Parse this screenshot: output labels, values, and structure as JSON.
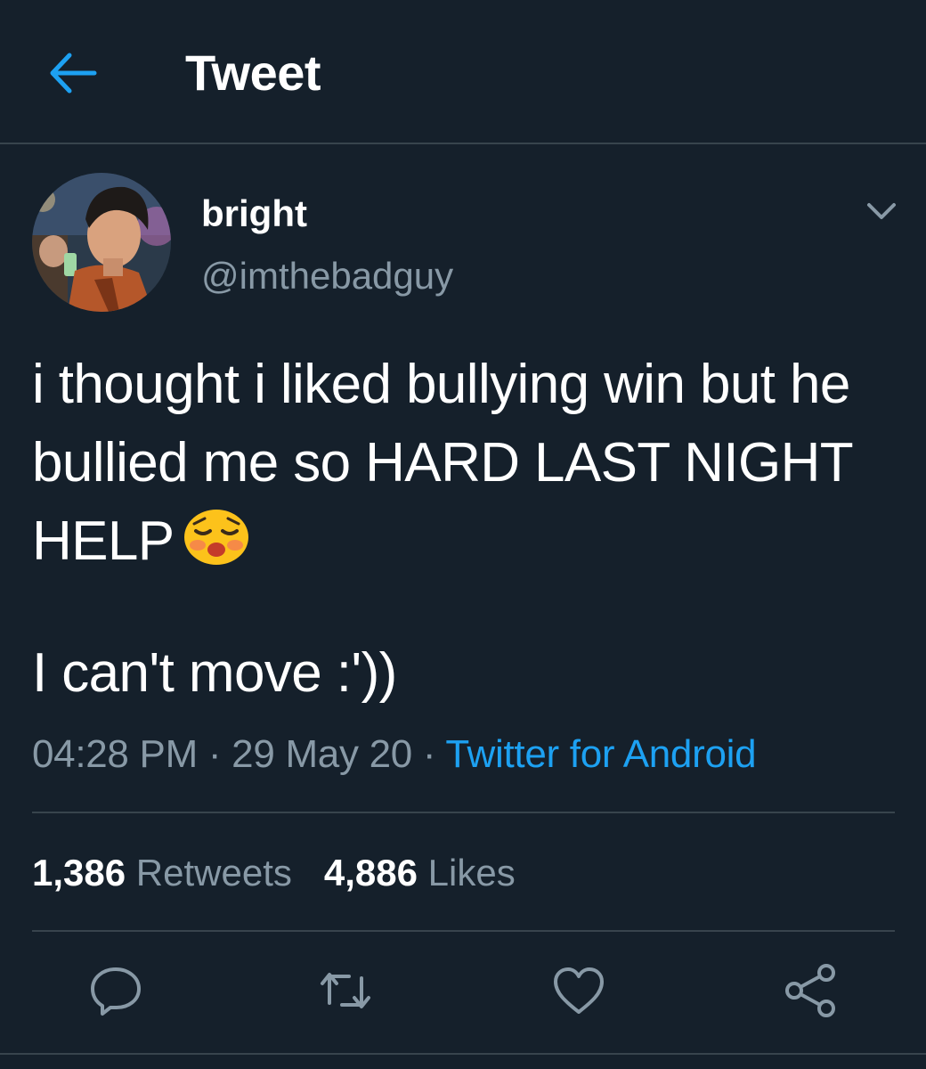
{
  "header": {
    "title": "Tweet",
    "back_icon": "arrow-left-icon",
    "accent_color": "#1da1f2"
  },
  "author": {
    "display_name": "bright",
    "handle": "@imthebadguy",
    "avatar_icon": "profile-photo",
    "menu_icon": "chevron-down-icon"
  },
  "tweet": {
    "lines": [
      "i thought i liked bullying win but he",
      "bullied me so HARD LAST NIGHT",
      "HELP"
    ],
    "emoji": "flushed-face-emoji",
    "second_paragraph": "I can't move :'))"
  },
  "meta": {
    "time": "04:28 PM",
    "separator": "·",
    "date": "29 May 20",
    "source": "Twitter for Android"
  },
  "stats": {
    "retweets_count": "1,386",
    "retweets_label": "Retweets",
    "likes_count": "4,886",
    "likes_label": "Likes"
  },
  "actions": [
    {
      "icon": "reply-icon"
    },
    {
      "icon": "retweet-icon"
    },
    {
      "icon": "like-icon"
    },
    {
      "icon": "share-icon"
    }
  ],
  "colors": {
    "background": "#15202b",
    "divider": "#38444d",
    "secondary_text": "#8899a6",
    "primary_text": "#ffffff"
  }
}
